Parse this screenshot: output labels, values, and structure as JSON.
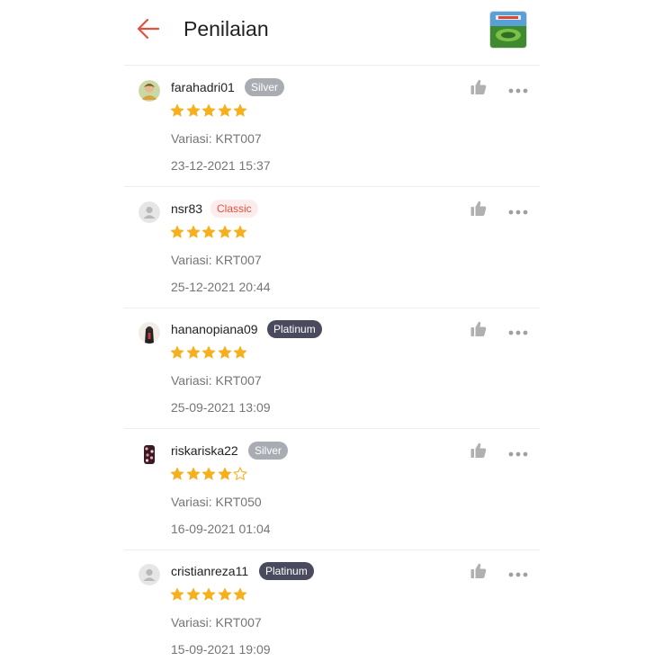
{
  "header": {
    "title": "Penilaian",
    "back_icon": "arrow-left-icon",
    "accent_color": "#e2523e"
  },
  "reviews": [
    {
      "username": "farahadri01",
      "badge": "Silver",
      "badge_type": "silver",
      "rating": 5,
      "variant": "Variasi: KRT007",
      "date": "23-12-2021 15:37",
      "avatar": "photo"
    },
    {
      "username": "nsr83",
      "badge": "Classic",
      "badge_type": "classic",
      "rating": 5,
      "variant": "Variasi: KRT007",
      "date": "25-12-2021 20:44",
      "avatar": "default-user-icon"
    },
    {
      "username": "hananopiana09",
      "badge": "Platinum",
      "badge_type": "platinum",
      "rating": 5,
      "variant": "Variasi: KRT007",
      "date": "25-09-2021 13:09",
      "avatar": "photo"
    },
    {
      "username": "riskariska22",
      "badge": "Silver",
      "badge_type": "silver",
      "rating": 4,
      "variant": "Variasi: KRT050",
      "date": "16-09-2021 01:04",
      "avatar": "photo"
    },
    {
      "username": "cristianreza11",
      "badge": "Platinum",
      "badge_type": "platinum",
      "rating": 5,
      "variant": "Variasi: KRT007",
      "date": "15-09-2021 19:09",
      "avatar": "default-user-icon"
    }
  ],
  "colors": {
    "star": "#f6b01e",
    "silver": "#a9acb3",
    "classic_bg": "#fdecec",
    "classic_text": "#e2523e",
    "platinum": "#4a4a5e"
  }
}
